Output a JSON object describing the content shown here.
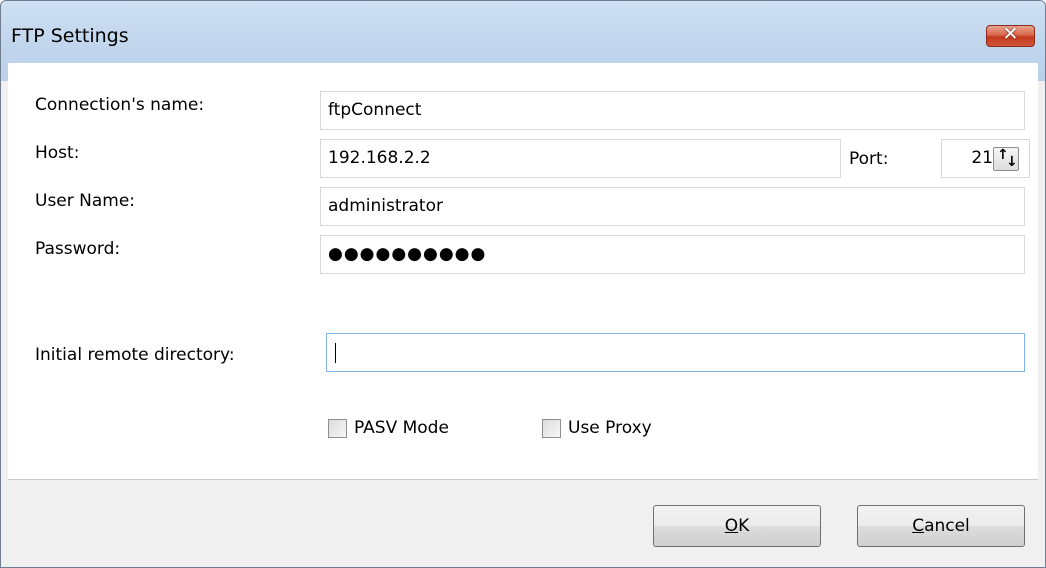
{
  "window": {
    "title": "FTP Settings",
    "close_glyph": "✕"
  },
  "form": {
    "connection_name": {
      "label": "Connection's name:",
      "value": "ftpConnect"
    },
    "host": {
      "label": "Host:",
      "value": "192.168.2.2"
    },
    "port": {
      "label": "Port:",
      "value": "21"
    },
    "user_name": {
      "label": "User Name:",
      "value": "administrator"
    },
    "password": {
      "label": "Password:",
      "value": "●●●●●●●●●●"
    },
    "initial_remote_directory": {
      "label": "Initial remote directory:",
      "value": ""
    }
  },
  "options": {
    "pasv_mode": {
      "label": "PASV Mode",
      "checked": false
    },
    "use_proxy": {
      "label": "Use Proxy",
      "checked": false
    }
  },
  "buttons": {
    "ok": {
      "mnemonic": "O",
      "rest": "K"
    },
    "cancel": {
      "mnemonic": "C",
      "rest": "ancel"
    }
  },
  "icons": {
    "close": "close-icon",
    "spin": "spin-arrows-icon"
  },
  "colors": {
    "titlebar": "#c3d7ee",
    "close_button": "#c4391d",
    "focus_border": "#7eb4ea"
  }
}
